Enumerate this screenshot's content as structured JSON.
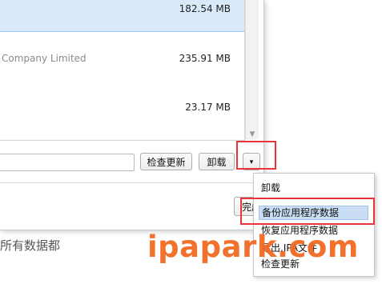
{
  "app_list": {
    "rows": [
      {
        "company": "",
        "size": "182.54 MB",
        "selected": true
      },
      {
        "company": "Company Limited",
        "size": "235.91 MB",
        "selected": false
      },
      {
        "company": "",
        "size": "23.17 MB",
        "selected": false
      }
    ]
  },
  "toolbar": {
    "check_update_label": "检查更新",
    "uninstall_label": "卸载",
    "dropdown_icon": "▾"
  },
  "footer": {
    "done_label": "完成",
    "bottom_text": "所有数据都"
  },
  "context_menu": {
    "items": [
      "卸载",
      "备份应用程序数据",
      "恢复应用程序数据",
      "导出.IPA文件",
      "检查更新"
    ],
    "selected_index": 1
  },
  "watermark": "ipapark.com",
  "colors": {
    "highlight": "#e8353a",
    "watermark": "#f26a21",
    "selection": "#d8eaf9"
  }
}
